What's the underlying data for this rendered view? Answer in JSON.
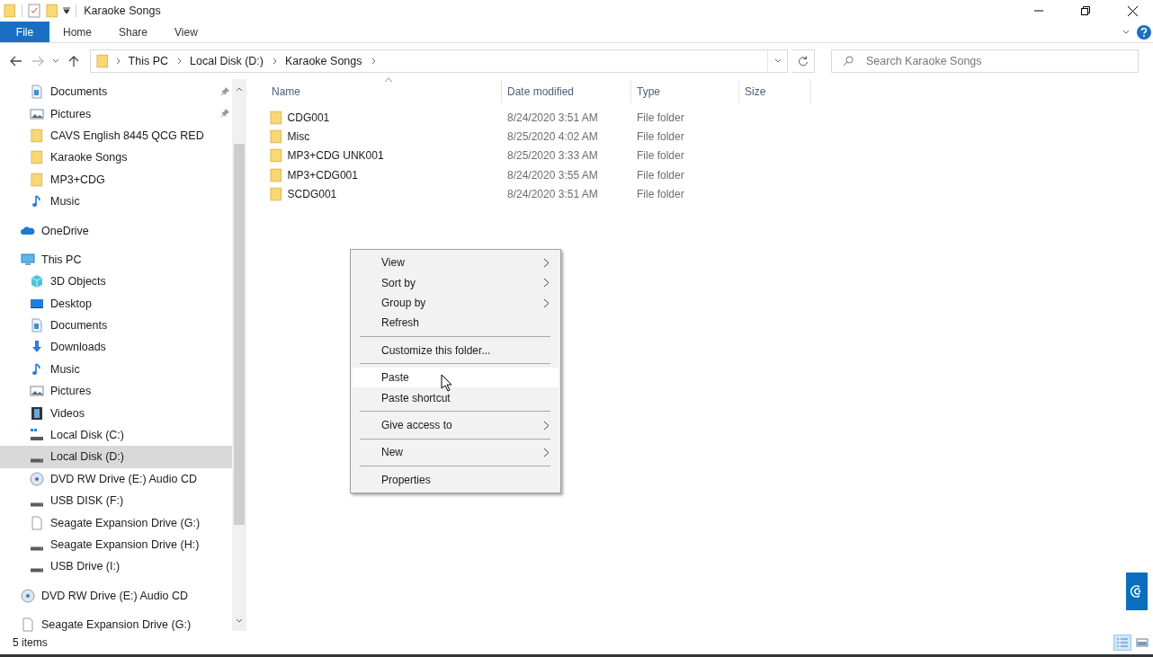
{
  "window": {
    "title": "Karaoke Songs"
  },
  "ribbon_tabs": [
    {
      "label": "File",
      "kind": "file"
    },
    {
      "label": "Home",
      "kind": "tab"
    },
    {
      "label": "Share",
      "kind": "tab"
    },
    {
      "label": "View",
      "kind": "tab"
    }
  ],
  "address_bar": {
    "crumbs": [
      "This PC",
      "Local Disk (D:)",
      "Karaoke Songs"
    ]
  },
  "search": {
    "placeholder": "Search Karaoke Songs"
  },
  "nav_pane": {
    "quick_access": [
      {
        "label": "Documents",
        "kind": "documents",
        "pinned": true,
        "selected": false
      },
      {
        "label": "Pictures",
        "kind": "pictures",
        "pinned": true,
        "selected": false
      },
      {
        "label": "CAVS English 8445 QCG RED",
        "kind": "folder",
        "pinned": false,
        "selected": false
      },
      {
        "label": "Karaoke Songs",
        "kind": "folder",
        "pinned": false,
        "selected": false
      },
      {
        "label": "MP3+CDG",
        "kind": "folder",
        "pinned": false,
        "selected": false
      },
      {
        "label": "Music",
        "kind": "music",
        "pinned": false,
        "selected": false
      }
    ],
    "tree": [
      {
        "label": "OneDrive",
        "kind": "cloud",
        "selected": false
      },
      {
        "label": "This PC",
        "kind": "pc",
        "selected": false,
        "children": [
          {
            "label": "3D Objects",
            "kind": "cube",
            "selected": false
          },
          {
            "label": "Desktop",
            "kind": "desktop",
            "selected": false
          },
          {
            "label": "Documents",
            "kind": "documents",
            "selected": false
          },
          {
            "label": "Downloads",
            "kind": "downloads",
            "selected": false
          },
          {
            "label": "Music",
            "kind": "music",
            "selected": false
          },
          {
            "label": "Pictures",
            "kind": "pictures",
            "selected": false
          },
          {
            "label": "Videos",
            "kind": "videos",
            "selected": false
          },
          {
            "label": "Local Disk (C:)",
            "kind": "osdrive",
            "selected": false
          },
          {
            "label": "Local Disk (D:)",
            "kind": "drive",
            "selected": true
          },
          {
            "label": "DVD RW Drive (E:) Audio CD",
            "kind": "cd",
            "selected": false
          },
          {
            "label": "USB DISK (F:)",
            "kind": "drive",
            "selected": false
          },
          {
            "label": "Seagate Expansion Drive (G:)",
            "kind": "blank",
            "selected": false
          },
          {
            "label": "Seagate Expansion Drive (H:)",
            "kind": "drive",
            "selected": false
          },
          {
            "label": "USB Drive (I:)",
            "kind": "drive",
            "selected": false
          }
        ]
      },
      {
        "label": "DVD RW Drive (E:) Audio CD",
        "kind": "cd",
        "selected": false
      },
      {
        "label": "Seagate Expansion Drive (G:)",
        "kind": "blank",
        "selected": false
      }
    ]
  },
  "file_list": {
    "columns": [
      {
        "label": "Name",
        "sorted": true
      },
      {
        "label": "Date modified",
        "sorted": false
      },
      {
        "label": "Type",
        "sorted": false
      },
      {
        "label": "Size",
        "sorted": false
      }
    ],
    "rows": [
      {
        "name": "CDG001",
        "date": "8/24/2020 3:51 AM",
        "type": "File folder"
      },
      {
        "name": "Misc",
        "date": "8/25/2020 4:02 AM",
        "type": "File folder"
      },
      {
        "name": "MP3+CDG UNK001",
        "date": "8/25/2020 3:33 AM",
        "type": "File folder"
      },
      {
        "name": "MP3+CDG001",
        "date": "8/24/2020 3:55 AM",
        "type": "File folder"
      },
      {
        "name": "SCDG001",
        "date": "8/24/2020 3:51 AM",
        "type": "File folder"
      }
    ]
  },
  "context_menu": {
    "items": [
      {
        "kind": "submenu",
        "label": "View",
        "selected": false
      },
      {
        "kind": "submenu",
        "label": "Sort by",
        "selected": false
      },
      {
        "kind": "submenu",
        "label": "Group by",
        "selected": false
      },
      {
        "kind": "item",
        "label": "Refresh",
        "selected": false
      },
      {
        "kind": "separator"
      },
      {
        "kind": "item",
        "label": "Customize this folder...",
        "selected": false
      },
      {
        "kind": "separator"
      },
      {
        "kind": "item",
        "label": "Paste",
        "selected": true
      },
      {
        "kind": "item",
        "label": "Paste shortcut",
        "selected": false
      },
      {
        "kind": "separator"
      },
      {
        "kind": "submenu",
        "label": "Give access to",
        "selected": false
      },
      {
        "kind": "separator"
      },
      {
        "kind": "submenu",
        "label": "New",
        "selected": false
      },
      {
        "kind": "separator"
      },
      {
        "kind": "item",
        "label": "Properties",
        "selected": false
      }
    ]
  },
  "status_bar": {
    "item_count": "5 items",
    "views": [
      {
        "kind": "details",
        "selected": true
      },
      {
        "kind": "tiles",
        "selected": false
      }
    ]
  }
}
